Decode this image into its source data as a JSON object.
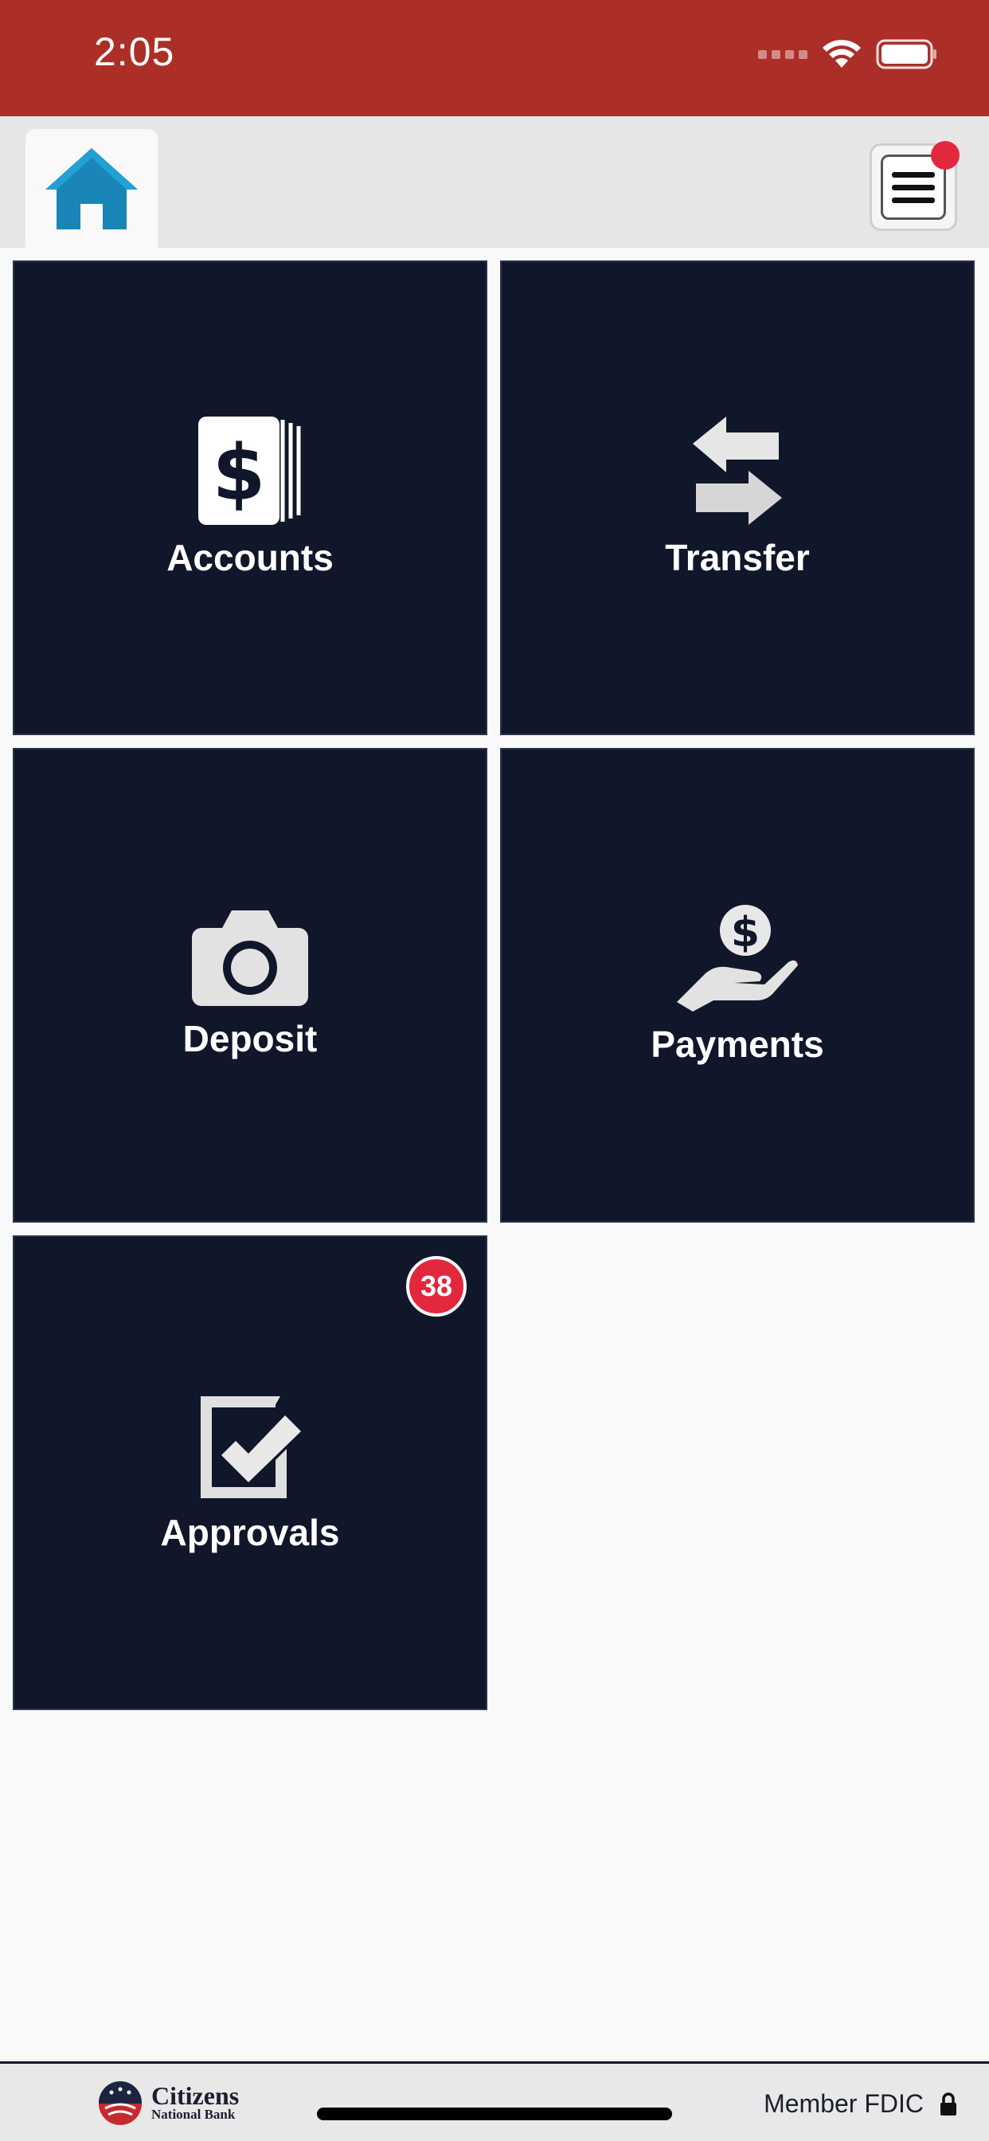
{
  "status_bar": {
    "time": "2:05"
  },
  "colors": {
    "status_bar_bg": "#ac2f27",
    "tile_bg": "#10172a",
    "badge_red": "#e2283d",
    "home_icon_blue": "#1a86b7"
  },
  "top_nav": {
    "home_icon": "home-icon",
    "menu_icon": "hamburger-menu-icon"
  },
  "tiles": [
    {
      "label": "Accounts",
      "icon": "dollar-cards-icon"
    },
    {
      "label": "Transfer",
      "icon": "transfer-arrows-icon"
    },
    {
      "label": "Deposit",
      "icon": "camera-icon"
    },
    {
      "label": "Payments",
      "icon": "hand-coin-icon"
    },
    {
      "label": "Approvals",
      "icon": "checkbox-approval-icon",
      "badge": "38"
    }
  ],
  "footer": {
    "logo_main": "Citizens",
    "logo_sub": "National Bank",
    "fdic_text": "Member FDIC",
    "lock_icon": "lock-icon"
  }
}
